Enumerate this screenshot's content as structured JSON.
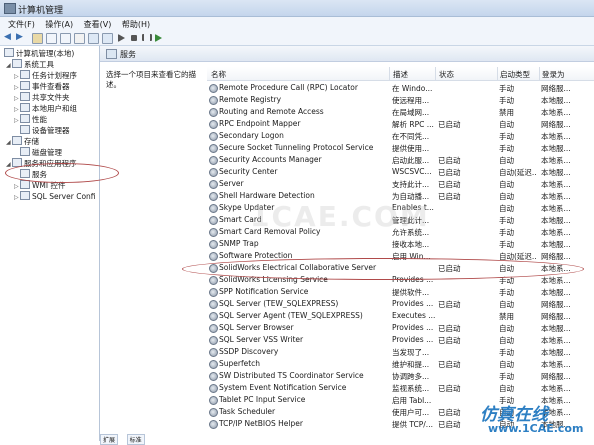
{
  "window": {
    "title": "计算机管理"
  },
  "menu": [
    "文件(F)",
    "操作(A)",
    "查看(V)",
    "帮助(H)"
  ],
  "tree": {
    "items": [
      {
        "label": "计算机管理(本地)",
        "level": 0
      },
      {
        "label": "系统工具",
        "level": 1
      },
      {
        "label": "任务计划程序",
        "level": 2
      },
      {
        "label": "事件查看器",
        "level": 2
      },
      {
        "label": "共享文件夹",
        "level": 2
      },
      {
        "label": "本地用户和组",
        "level": 2
      },
      {
        "label": "性能",
        "level": 2
      },
      {
        "label": "设备管理器",
        "level": 2
      },
      {
        "label": "存储",
        "level": 1
      },
      {
        "label": "磁盘管理",
        "level": 2
      },
      {
        "label": "服务和应用程序",
        "level": 1
      },
      {
        "label": "服务",
        "level": 2
      },
      {
        "label": "WMI 控件",
        "level": 2
      },
      {
        "label": "SQL Server Confi",
        "level": 2
      }
    ]
  },
  "header": {
    "label": "服务"
  },
  "description": {
    "text": "选择一个项目来查看它的描述。"
  },
  "columns": {
    "name": "名称",
    "desc": "描述",
    "status": "状态",
    "startup": "启动类型",
    "logon": "登录为"
  },
  "services": [
    {
      "name": "Remote Procedure Call (RPC) Locator",
      "desc": "在 Windo...",
      "status": "",
      "startup": "手动",
      "logon": "网络服..."
    },
    {
      "name": "Remote Registry",
      "desc": "使远程用...",
      "status": "",
      "startup": "手动",
      "logon": "本地服..."
    },
    {
      "name": "Routing and Remote Access",
      "desc": "在局域网...",
      "status": "",
      "startup": "禁用",
      "logon": "本地系..."
    },
    {
      "name": "RPC Endpoint Mapper",
      "desc": "解析 RPC ...",
      "status": "已启动",
      "startup": "自动",
      "logon": "网络服..."
    },
    {
      "name": "Secondary Logon",
      "desc": "在不同凭...",
      "status": "",
      "startup": "手动",
      "logon": "本地系..."
    },
    {
      "name": "Secure Socket Tunneling Protocol Service",
      "desc": "提供使用...",
      "status": "",
      "startup": "手动",
      "logon": "本地服..."
    },
    {
      "name": "Security Accounts Manager",
      "desc": "启动此服...",
      "status": "已启动",
      "startup": "自动",
      "logon": "本地系..."
    },
    {
      "name": "Security Center",
      "desc": "WSCSVC...",
      "status": "已启动",
      "startup": "自动(延迟...",
      "logon": "本地服..."
    },
    {
      "name": "Server",
      "desc": "支持此计...",
      "status": "已启动",
      "startup": "自动",
      "logon": "本地系..."
    },
    {
      "name": "Shell Hardware Detection",
      "desc": "为自动播...",
      "status": "已启动",
      "startup": "自动",
      "logon": "本地系..."
    },
    {
      "name": "Skype Updater",
      "desc": "Enables t...",
      "status": "",
      "startup": "自动",
      "logon": "本地系..."
    },
    {
      "name": "Smart Card",
      "desc": "管理此计...",
      "status": "",
      "startup": "手动",
      "logon": "本地服..."
    },
    {
      "name": "Smart Card Removal Policy",
      "desc": "允许系统...",
      "status": "",
      "startup": "手动",
      "logon": "本地系..."
    },
    {
      "name": "SNMP Trap",
      "desc": "接收本地...",
      "status": "",
      "startup": "手动",
      "logon": "本地服..."
    },
    {
      "name": "Software Protection",
      "desc": "启用 Win...",
      "status": "",
      "startup": "自动(延迟...",
      "logon": "网络服..."
    },
    {
      "name": "SolidWorks Electrical Collaborative Server",
      "desc": "",
      "status": "已启动",
      "startup": "自动",
      "logon": "本地系..."
    },
    {
      "name": "SolidWorks Licensing Service",
      "desc": "Provides ...",
      "status": "",
      "startup": "手动",
      "logon": "本地系..."
    },
    {
      "name": "SPP Notification Service",
      "desc": "提供软件...",
      "status": "",
      "startup": "手动",
      "logon": "本地服..."
    },
    {
      "name": "SQL Server (TEW_SQLEXPRESS)",
      "desc": "Provides ...",
      "status": "已启动",
      "startup": "自动",
      "logon": "网络服..."
    },
    {
      "name": "SQL Server Agent (TEW_SQLEXPRESS)",
      "desc": "Executes ...",
      "status": "",
      "startup": "禁用",
      "logon": "网络服..."
    },
    {
      "name": "SQL Server Browser",
      "desc": "Provides ...",
      "status": "已启动",
      "startup": "自动",
      "logon": "本地服..."
    },
    {
      "name": "SQL Server VSS Writer",
      "desc": "Provides ...",
      "status": "已启动",
      "startup": "自动",
      "logon": "本地系..."
    },
    {
      "name": "SSDP Discovery",
      "desc": "当发现了...",
      "status": "",
      "startup": "手动",
      "logon": "本地服..."
    },
    {
      "name": "Superfetch",
      "desc": "维护和提...",
      "status": "已启动",
      "startup": "自动",
      "logon": "本地系..."
    },
    {
      "name": "SW Distributed TS Coordinator Service",
      "desc": "协调跨多...",
      "status": "",
      "startup": "手动",
      "logon": "网络服..."
    },
    {
      "name": "System Event Notification Service",
      "desc": "监视系统...",
      "status": "已启动",
      "startup": "自动",
      "logon": "本地系..."
    },
    {
      "name": "Tablet PC Input Service",
      "desc": "启用 Tabl...",
      "status": "",
      "startup": "手动",
      "logon": "本地系..."
    },
    {
      "name": "Task Scheduler",
      "desc": "使用户可...",
      "status": "已启动",
      "startup": "自动",
      "logon": "本地系..."
    },
    {
      "name": "TCP/IP NetBIOS Helper",
      "desc": "提供 TCP/...",
      "status": "已启动",
      "startup": "自动",
      "logon": "本地服..."
    }
  ],
  "bottom_tabs": [
    "扩展",
    "标准"
  ],
  "watermark": "1CAE.COM",
  "brand": {
    "cn": "仿真在线",
    "url": "www.1CAE.com"
  },
  "annotation_color": "#b04a4a"
}
